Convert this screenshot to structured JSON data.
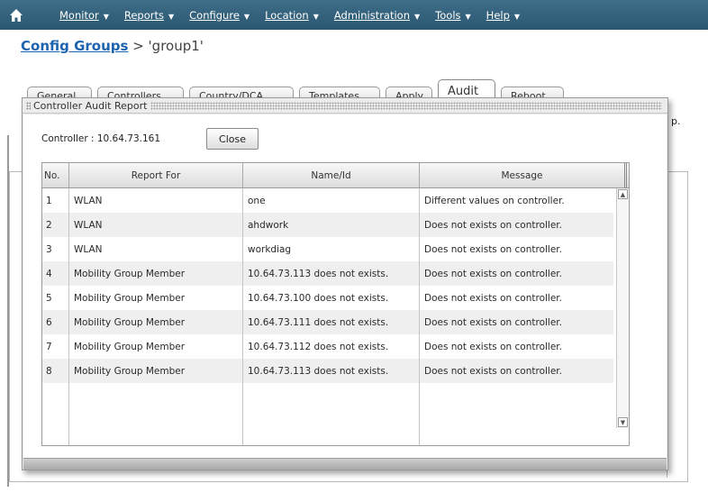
{
  "nav": {
    "menu": [
      {
        "label": "Monitor"
      },
      {
        "label": "Reports"
      },
      {
        "label": "Configure"
      },
      {
        "label": "Location"
      },
      {
        "label": "Administration"
      },
      {
        "label": "Tools"
      },
      {
        "label": "Help"
      }
    ]
  },
  "breadcrumb": {
    "link": "Config Groups",
    "separator": " > ",
    "current": "'group1'"
  },
  "tabs": [
    {
      "label": "General"
    },
    {
      "label": "Controllers"
    },
    {
      "label": "Country/DCA"
    },
    {
      "label": "Templates"
    },
    {
      "label": "Apply"
    },
    {
      "label": "Audit"
    },
    {
      "label": "Reboot"
    }
  ],
  "background": {
    "side_text": "p."
  },
  "dialog": {
    "title": "Controller Audit Report",
    "controller_label": "Controller : 10.64.73.161",
    "close_label": "Close",
    "columns": [
      "No.",
      "Report For",
      "Name/Id",
      "Message"
    ],
    "rows": [
      {
        "no": "1",
        "report_for": "WLAN",
        "name_id": "one",
        "message": "Different values on controller."
      },
      {
        "no": "2",
        "report_for": "WLAN",
        "name_id": "ahdwork",
        "message": "Does not exists on controller."
      },
      {
        "no": "3",
        "report_for": "WLAN",
        "name_id": "workdiag",
        "message": "Does not exists on controller."
      },
      {
        "no": "4",
        "report_for": "Mobility Group Member",
        "name_id": "10.64.73.113 does not exists.",
        "message": "Does not exists on controller."
      },
      {
        "no": "5",
        "report_for": "Mobility Group Member",
        "name_id": "10.64.73.100 does not exists.",
        "message": "Does not exists on controller."
      },
      {
        "no": "6",
        "report_for": "Mobility Group Member",
        "name_id": "10.64.73.111 does not exists.",
        "message": "Does not exists on controller."
      },
      {
        "no": "7",
        "report_for": "Mobility Group Member",
        "name_id": "10.64.73.112 does not exists.",
        "message": "Does not exists on controller."
      },
      {
        "no": "8",
        "report_for": "Mobility Group Member",
        "name_id": "10.64.73.113 does not exists.",
        "message": "Does not exists on controller."
      }
    ]
  },
  "colors": {
    "nav_bg": "#2a5670",
    "link": "#1e63b0",
    "row_alt": "#efefef"
  }
}
